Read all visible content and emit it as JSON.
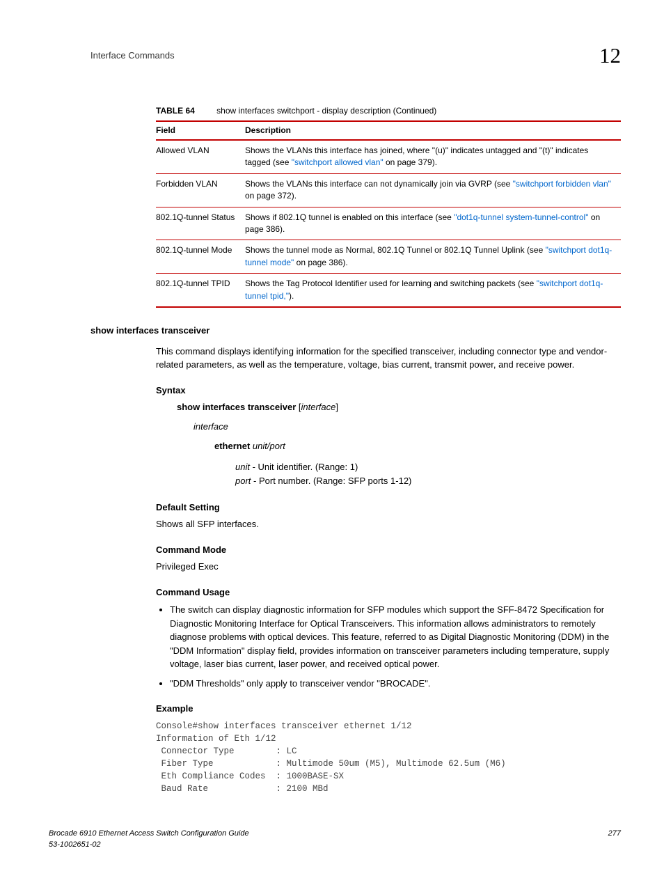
{
  "header": {
    "title": "Interface Commands",
    "chapter": "12"
  },
  "table": {
    "label": "TABLE 64",
    "caption": "show interfaces switchport - display description (Continued)",
    "col1": "Field",
    "col2": "Description",
    "rows": [
      {
        "field": "Allowed VLAN",
        "desc_pre": "Shows the VLANs this interface has joined, where \"(u)\" indicates untagged and \"(t)\" indicates tagged (see ",
        "link": "\"switchport allowed vlan\"",
        "desc_post": " on page 379)."
      },
      {
        "field": "Forbidden VLAN",
        "desc_pre": "Shows the VLANs this interface can not dynamically join via GVRP (see ",
        "link": "\"switchport forbidden vlan\"",
        "desc_post": " on page 372)."
      },
      {
        "field": "802.1Q-tunnel Status",
        "desc_pre": "Shows if 802.1Q tunnel is enabled on this interface (see ",
        "link": "\"dot1q-tunnel system-tunnel-control\"",
        "desc_post": " on page 386)."
      },
      {
        "field": "802.1Q-tunnel Mode",
        "desc_pre": "Shows the tunnel mode as Normal, 802.1Q Tunnel or 802.1Q Tunnel Uplink (see ",
        "link": "\"switchport dot1q-tunnel mode\"",
        "desc_post": " on page 386)."
      },
      {
        "field": "802.1Q-tunnel TPID",
        "desc_pre": "Shows the Tag Protocol Identifier used for learning and switching packets (see ",
        "link": "\"switchport dot1q-tunnel tpid,\"",
        "desc_post": ")."
      }
    ]
  },
  "section": {
    "heading": "show interfaces transceiver",
    "intro": "This command displays identifying information for the specified transceiver, including connector type and vendor-related parameters, as well as the temperature, voltage, bias current, transmit power, and receive power.",
    "syntax_label": "Syntax",
    "syntax_cmd_bold": "show interfaces transceiver",
    "syntax_cmd_rest": " [",
    "syntax_cmd_italic": "interface",
    "syntax_cmd_close": "]",
    "interface_label": "interface",
    "ethernet_bold": "ethernet",
    "ethernet_rest": " unit/port",
    "unit_label": "unit",
    "unit_desc": " - Unit identifier. (Range: 1)",
    "port_label": "port",
    "port_desc": " - Port number. (Range: SFP ports 1-12)",
    "default_label": "Default Setting",
    "default_text": "Shows all SFP interfaces.",
    "mode_label": "Command Mode",
    "mode_text": "Privileged Exec",
    "usage_label": "Command Usage",
    "usage_bullets": [
      "The switch can display diagnostic information for SFP modules which support the SFF-8472 Specification for Diagnostic Monitoring Interface for Optical Transceivers. This information allows administrators to remotely diagnose problems with optical devices. This feature, referred to as Digital Diagnostic Monitoring (DDM) in the \"DDM Information\" display field, provides information on transceiver parameters including temperature, supply voltage, laser bias current, laser power, and received optical power.",
      "\"DDM Thresholds\" only apply to transceiver vendor \"BROCADE\"."
    ],
    "example_label": "Example",
    "example_text": "Console#show interfaces transceiver ethernet 1/12\nInformation of Eth 1/12\n Connector Type        : LC\n Fiber Type            : Multimode 50um (M5), Multimode 62.5um (M6)\n Eth Compliance Codes  : 1000BASE-SX\n Baud Rate             : 2100 MBd"
  },
  "footer": {
    "left1": "Brocade 6910 Ethernet Access Switch Configuration Guide",
    "left2": "53-1002651-02",
    "right": "277"
  }
}
